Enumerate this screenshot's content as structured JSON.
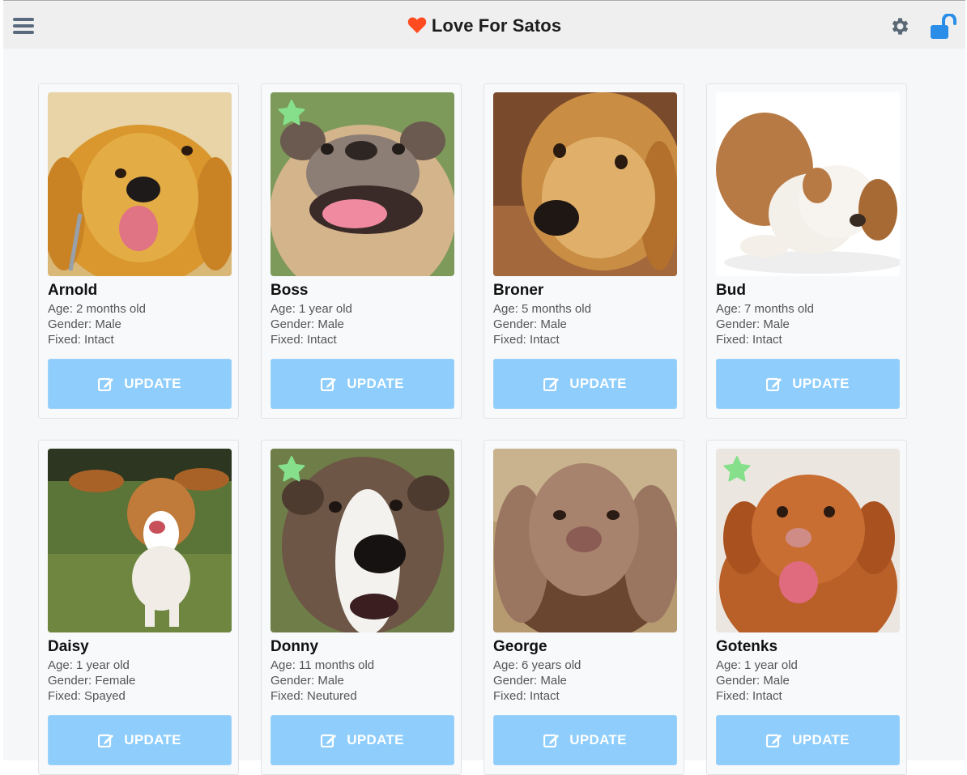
{
  "header": {
    "title": "Love For Satos",
    "brand_color": "#ff4b1f",
    "icons": [
      "menu-icon",
      "heart-icon",
      "gear-icon",
      "unlock-icon"
    ]
  },
  "colors": {
    "accent": "#8ecdfc",
    "favorite_star": "#86e08b",
    "unlock": "#2a8ee8"
  },
  "dogs": [
    {
      "name": "Arnold",
      "age": "Age: 2 months old",
      "gender": "Gender: Male",
      "fixed": "Fixed: Intact",
      "favorite": false,
      "update_label": "UPDATE"
    },
    {
      "name": "Boss",
      "age": "Age: 1 year old",
      "gender": "Gender: Male",
      "fixed": "Fixed: Intact",
      "favorite": true,
      "update_label": "UPDATE"
    },
    {
      "name": "Broner",
      "age": "Age: 5 months old",
      "gender": "Gender: Male",
      "fixed": "Fixed: Intact",
      "favorite": false,
      "update_label": "UPDATE"
    },
    {
      "name": "Bud",
      "age": "Age: 7 months old",
      "gender": "Gender: Male",
      "fixed": "Fixed: Intact",
      "favorite": false,
      "update_label": "UPDATE"
    },
    {
      "name": "Daisy",
      "age": "Age: 1 year old",
      "gender": "Gender: Female",
      "fixed": "Fixed: Spayed",
      "favorite": false,
      "update_label": "UPDATE"
    },
    {
      "name": "Donny",
      "age": "Age: 11 months old",
      "gender": "Gender: Male",
      "fixed": "Fixed: Neutured",
      "favorite": true,
      "update_label": "UPDATE"
    },
    {
      "name": "George",
      "age": "Age: 6 years old",
      "gender": "Gender: Male",
      "fixed": "Fixed: Intact",
      "favorite": false,
      "update_label": "UPDATE"
    },
    {
      "name": "Gotenks",
      "age": "Age: 1 year old",
      "gender": "Gender: Male",
      "fixed": "Fixed: Intact",
      "favorite": true,
      "update_label": "UPDATE"
    }
  ]
}
